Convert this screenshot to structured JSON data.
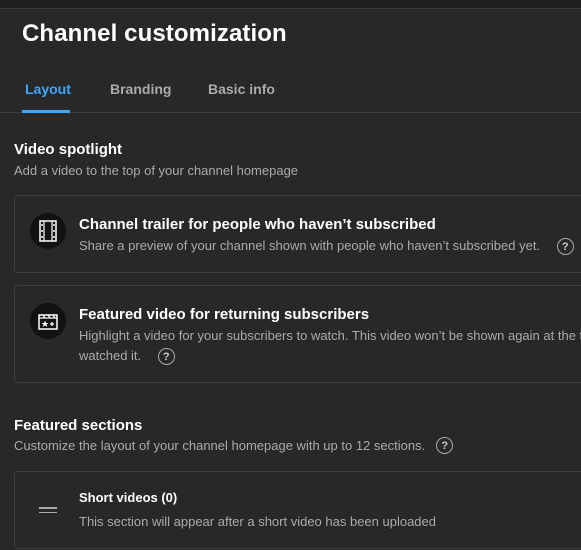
{
  "header": {
    "title": "Channel customization"
  },
  "tabs": [
    {
      "label": "Layout",
      "active": true
    },
    {
      "label": "Branding",
      "active": false
    },
    {
      "label": "Basic info",
      "active": false
    }
  ],
  "video_spotlight": {
    "title": "Video spotlight",
    "description": "Add a video to the top of your channel homepage",
    "cards": [
      {
        "icon": "film-strip-icon",
        "title": "Channel trailer for people who haven’t subscribed",
        "description": "Share a preview of your channel shown with people who haven’t subscribed yet."
      },
      {
        "icon": "featured-video-icon",
        "title": "Featured video for returning subscribers",
        "description_line1": "Highlight a video for your subscribers to watch. This video won’t be shown again at the t",
        "description_line2": "watched it."
      }
    ]
  },
  "featured_sections": {
    "title": "Featured sections",
    "description": "Customize the layout of your channel homepage with up to 12 sections.",
    "items": [
      {
        "title": "Short videos (0)",
        "description": "This section will appear after a short video has been uploaded"
      }
    ]
  },
  "colors": {
    "accent": "#3ea6ff",
    "background": "#282828",
    "muted_text": "#aaaaaa",
    "border": "#3e3e3e"
  }
}
